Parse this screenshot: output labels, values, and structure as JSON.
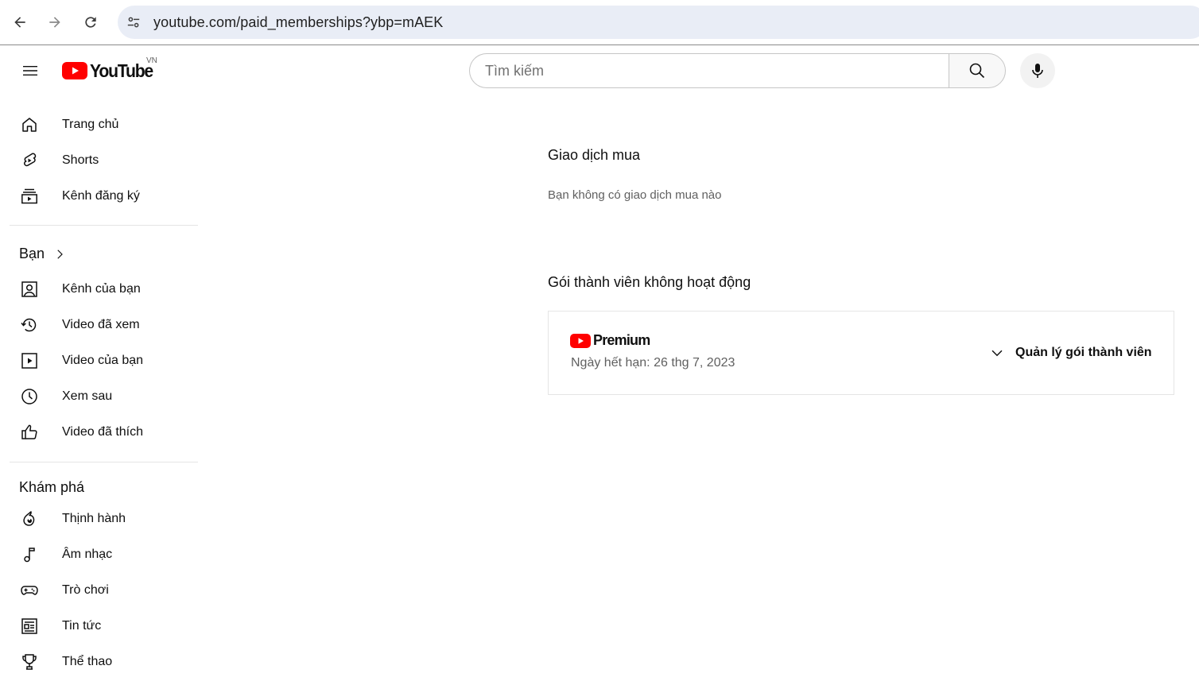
{
  "browser": {
    "url": "youtube.com/paid_memberships?ybp=mAEK",
    "icons": [
      "back-arrow-icon",
      "forward-arrow-icon",
      "reload-icon",
      "site-settings-icon"
    ]
  },
  "header": {
    "logo_text": "YouTube",
    "region": "VN",
    "search_placeholder": "Tìm kiếm",
    "search_value": "",
    "icons": [
      "menu-icon",
      "search-icon",
      "microphone-icon"
    ]
  },
  "sidebar": {
    "main_items": [
      {
        "label": "Trang chủ",
        "icon": "home-icon"
      },
      {
        "label": "Shorts",
        "icon": "shorts-icon"
      },
      {
        "label": "Kênh đăng ký",
        "icon": "subscriptions-icon"
      }
    ],
    "you_section": {
      "title": "Bạn",
      "items": [
        {
          "label": "Kênh của bạn",
          "icon": "your-channel-icon"
        },
        {
          "label": "Video đã xem",
          "icon": "history-icon"
        },
        {
          "label": "Video của bạn",
          "icon": "your-videos-icon"
        },
        {
          "label": "Xem sau",
          "icon": "watch-later-icon"
        },
        {
          "label": "Video đã thích",
          "icon": "liked-icon"
        }
      ]
    },
    "explore_section": {
      "title": "Khám phá",
      "items": [
        {
          "label": "Thịnh hành",
          "icon": "trending-icon"
        },
        {
          "label": "Âm nhạc",
          "icon": "music-icon"
        },
        {
          "label": "Trò chơi",
          "icon": "gaming-icon"
        },
        {
          "label": "Tin tức",
          "icon": "news-icon"
        },
        {
          "label": "Thể thao",
          "icon": "sports-icon"
        }
      ]
    }
  },
  "main": {
    "purchases_title": "Giao dịch mua",
    "purchases_empty": "Bạn không có giao dịch mua nào",
    "inactive_title": "Gói thành viên không hoạt động",
    "membership": {
      "product": "Premium",
      "expiry": "Ngày hết hạn: 26 thg 7, 2023",
      "manage_label": "Quản lý gói thành viên"
    }
  },
  "colors": {
    "brand_red": "#ff0000",
    "address_bar": "#e9edf6",
    "text_primary": "#0f0f0f",
    "text_secondary": "#606060"
  }
}
